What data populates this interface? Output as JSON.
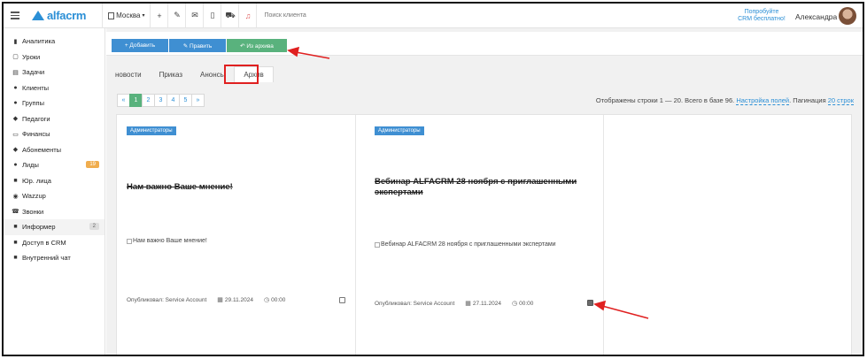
{
  "topbar": {
    "logo": "alfacrm",
    "city": "Москва",
    "search_placeholder": "Поиск клиента",
    "promo_line1": "Попробуйте",
    "promo_line2": "CRM бесплатно!",
    "user_name": "Александра",
    "icons": [
      "plus-icon",
      "wrench-icon",
      "mail-icon",
      "mobile-icon",
      "cart-icon",
      "bell-icon"
    ]
  },
  "sidebar": {
    "items": [
      {
        "label": "Аналитика",
        "icon": "chart-icon",
        "glyph": "▮"
      },
      {
        "label": "Уроки",
        "icon": "calendar-icon",
        "glyph": "▢"
      },
      {
        "label": "Задачи",
        "icon": "tasks-icon",
        "glyph": "▤"
      },
      {
        "label": "Клиенты",
        "icon": "user-icon",
        "glyph": "●"
      },
      {
        "label": "Группы",
        "icon": "users-icon",
        "glyph": "●"
      },
      {
        "label": "Педагоги",
        "icon": "graduation-icon",
        "glyph": "◆"
      },
      {
        "label": "Финансы",
        "icon": "money-icon",
        "glyph": "▭"
      },
      {
        "label": "Абонементы",
        "icon": "tag-icon",
        "glyph": "◆"
      },
      {
        "label": "Лиды",
        "icon": "user-plus-icon",
        "glyph": "●",
        "badge": "19"
      },
      {
        "label": "Юр. лица",
        "icon": "briefcase-icon",
        "glyph": "■"
      },
      {
        "label": "Wazzup",
        "icon": "whatsapp-icon",
        "glyph": "◉"
      },
      {
        "label": "Звонки",
        "icon": "phone-icon",
        "glyph": "☎"
      },
      {
        "label": "Информер",
        "icon": "informer-icon",
        "glyph": "■",
        "badge": "2"
      },
      {
        "label": "Доступ в CRM",
        "icon": "lock-icon",
        "glyph": "■"
      },
      {
        "label": "Внутренний чат",
        "icon": "chat-icon",
        "glyph": "■"
      }
    ]
  },
  "toolbar": {
    "add_label": "+ Добавить",
    "edit_label": "✎ Править",
    "from_archive_label": "↶ Из архива"
  },
  "tabs": [
    "новости",
    "Приказ",
    "Анонсы",
    "Архив"
  ],
  "active_tab": "Архив",
  "pagination": {
    "prev": "«",
    "pages": [
      "1",
      "2",
      "3",
      "4",
      "5"
    ],
    "next": "»",
    "current": "1",
    "info_text": "Отображены строки 1 — 20. Всего в базе 96.",
    "settings_link": "Настройка полей",
    "pagination_label": "Пагинация",
    "pagination_value": "20 строк"
  },
  "cards": [
    {
      "tag": "Администраторы",
      "title": "Нам важно Ваше мнение!",
      "image_alt": "Нам важно Ваше мнение!",
      "published": "Опубликовал: Service Account",
      "date": "29.11.2024",
      "time": "00:00",
      "checked": false
    },
    {
      "tag": "Администраторы",
      "title": "Вебинар ALFACRM 28 ноября с приглашенными экспертами",
      "image_alt": "Вебинар ALFACRM 28 ноября с приглашенными экспертами",
      "published": "Опубликовал: Service Account",
      "date": "27.11.2024",
      "time": "00:00",
      "checked": true
    }
  ],
  "colors": {
    "brand": "#2b8fd6",
    "button_blue": "#3f8fd2",
    "button_green": "#59b27d",
    "annotation_red": "#e02020",
    "badge_orange": "#f0ad4e"
  }
}
